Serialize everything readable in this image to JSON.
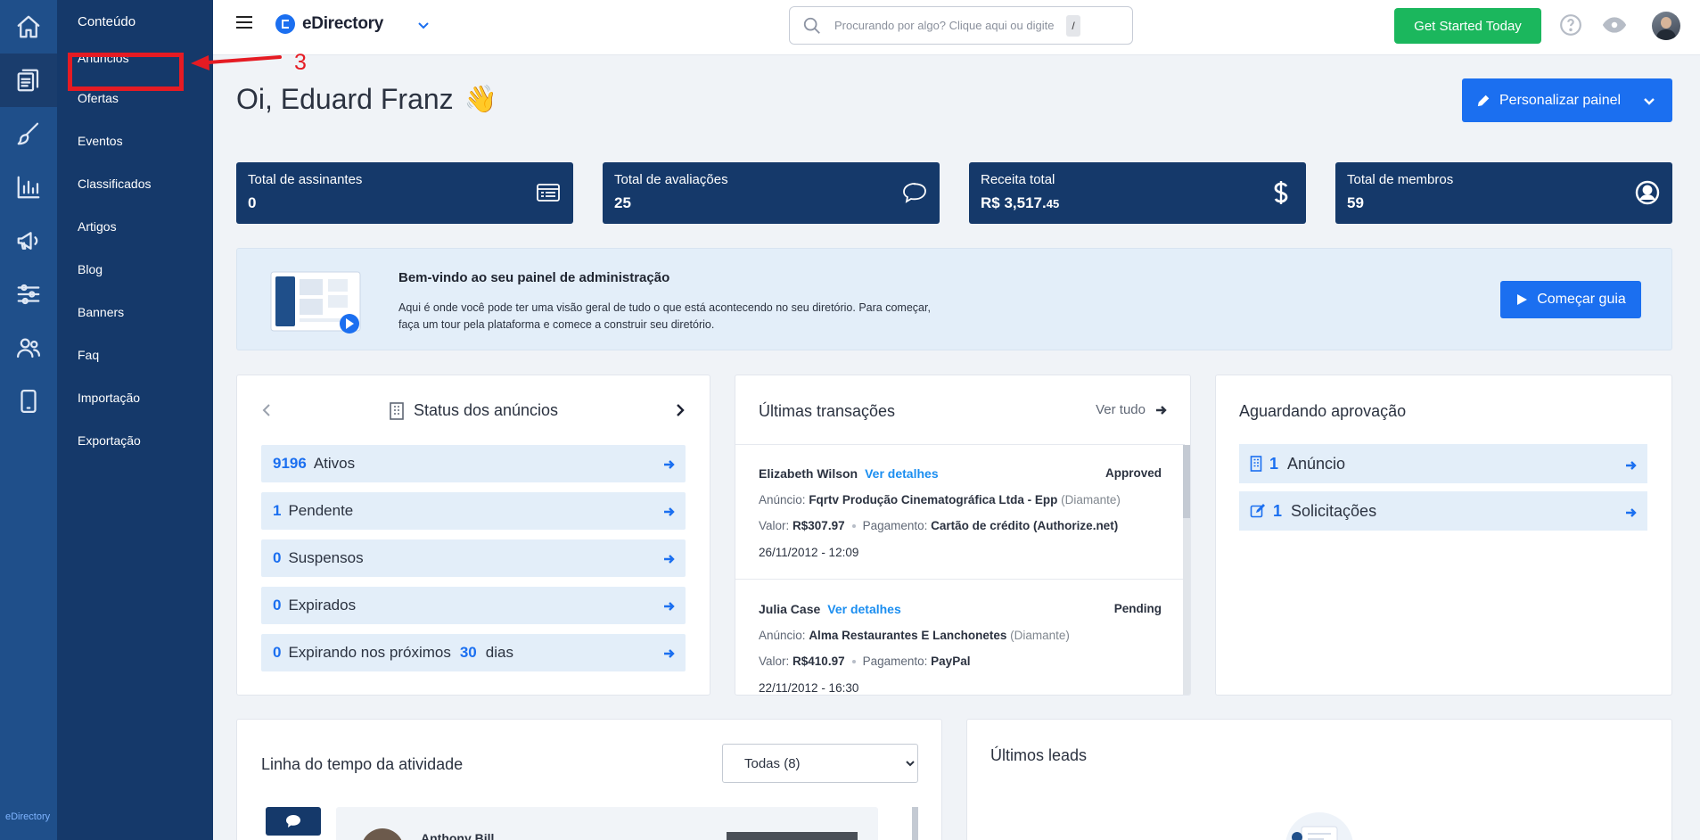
{
  "sidebar": {
    "section_title": "Conteúdo",
    "items": [
      "Anúncios",
      "Ofertas",
      "Eventos",
      "Classificados",
      "Artigos",
      "Blog",
      "Banners",
      "Faq",
      "Importação",
      "Exportação"
    ],
    "brand": "eDirectory"
  },
  "topbar": {
    "logo_text": "eDirectory",
    "search_placeholder": "Procurando por algo? Clique aqui ou digite",
    "search_shortcut": "/",
    "get_started_label": "Get Started Today"
  },
  "greeting": {
    "text": "Oi, Eduard Franz",
    "emoji": "👋",
    "personalize_label": "Personalizar painel"
  },
  "stats": [
    {
      "label": "Total de assinantes",
      "value": "0",
      "icon": "list-icon"
    },
    {
      "label": "Total de avaliações",
      "value": "25",
      "icon": "chat-icon"
    },
    {
      "label": "Receita total",
      "value_main": "R$ 3,517.",
      "value_cents": "45",
      "icon": "dollar-icon"
    },
    {
      "label": "Total de membros",
      "value": "59",
      "icon": "user-icon"
    }
  ],
  "welcome": {
    "title": "Bem-vindo ao seu painel de administração",
    "text": "Aqui é onde você pode ter uma visão geral de tudo o que está acontecendo no seu diretório. Para começar, faça um tour pela plataforma e comece a construir seu diretório.",
    "button_label": "Começar guia"
  },
  "listing_status": {
    "title": "Status dos anúncios",
    "rows": [
      {
        "count": "9196",
        "label": "Ativos"
      },
      {
        "count": "1",
        "label": "Pendente"
      },
      {
        "count": "0",
        "label": "Suspensos"
      },
      {
        "count": "0",
        "label": "Expirados"
      },
      {
        "count": "0",
        "label": "Expirando nos próximos",
        "days": "30",
        "suffix": "dias"
      }
    ]
  },
  "transactions": {
    "title": "Últimas transações",
    "see_all": "Ver tudo",
    "items": [
      {
        "name": "Elizabeth Wilson",
        "details_link": "Ver detalhes",
        "status": "Approved",
        "listing_label": "Anúncio:",
        "listing": "Fqrtv Produção Cinematográfica Ltda - Epp",
        "level": "(Diamante)",
        "value_label": "Valor:",
        "value": "R$307.97",
        "payment_label": "Pagamento:",
        "payment": "Cartão de crédito (Authorize.net)",
        "date": "26/11/2012 - 12:09"
      },
      {
        "name": "Julia Case",
        "details_link": "Ver detalhes",
        "status": "Pending",
        "listing_label": "Anúncio:",
        "listing": "Alma Restaurantes E Lanchonetes",
        "level": "(Diamante)",
        "value_label": "Valor:",
        "value": "R$410.97",
        "payment_label": "Pagamento:",
        "payment": "PayPal",
        "date": "22/11/2012 - 16:30"
      }
    ]
  },
  "approval": {
    "title": "Aguardando aprovação",
    "rows": [
      {
        "count": "1",
        "label": "Anúncio"
      },
      {
        "count": "1",
        "label": "Solicitações"
      }
    ]
  },
  "timeline": {
    "title": "Linha do tempo da atividade",
    "filter_selected": "Todas (8)",
    "first_entry_name": "Anthony Bill"
  },
  "leads": {
    "title": "Últimos leads"
  },
  "annotation": {
    "step_number": "3",
    "color": "#e51b23"
  },
  "colors": {
    "primary": "#1b6ff0",
    "navy": "#15396a",
    "rail": "#1f4f8a",
    "success": "#1bb75d"
  }
}
